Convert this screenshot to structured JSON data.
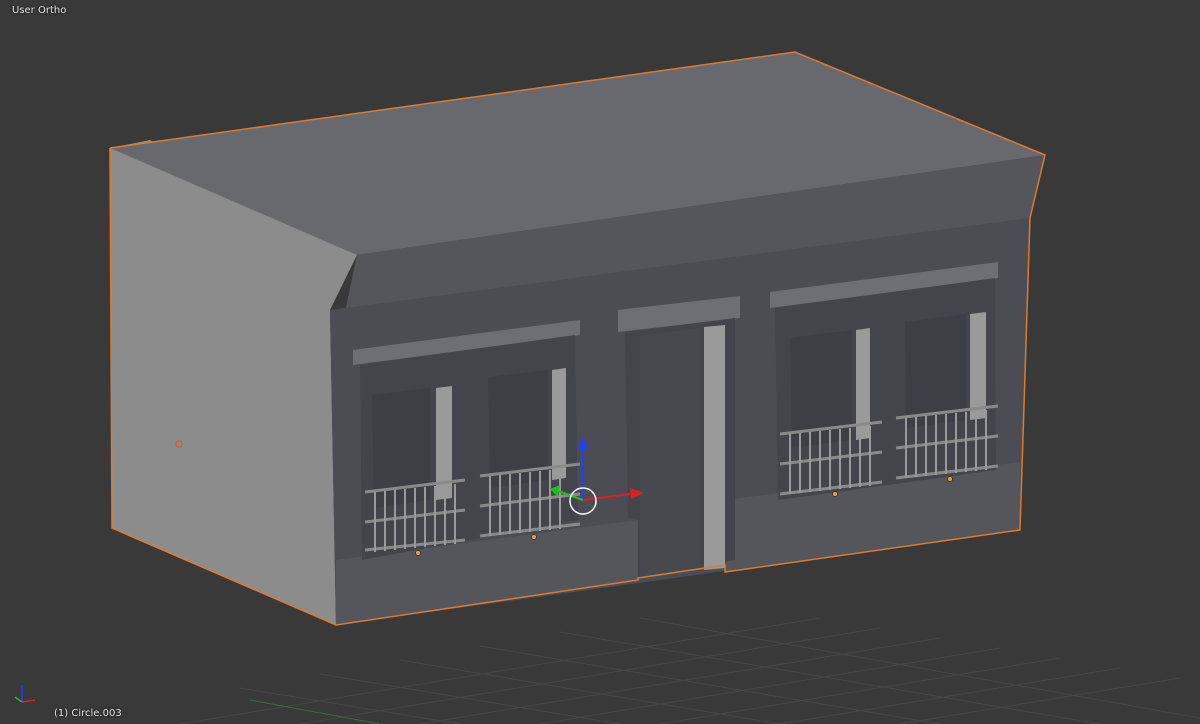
{
  "viewport": {
    "view_name": "User Ortho",
    "active_object": "(1) Circle.003",
    "background_color": "#393939",
    "grid_color": "#4a4a4a",
    "selection_outline_color": "#e07a2e"
  },
  "model": {
    "description_icon": "building-mesh",
    "wall_color": "#4e4e58",
    "side_wall_color": "#8a8a8a",
    "roof_color": "#6a6a73",
    "trim_color": "#8c8c8c"
  },
  "gizmo": {
    "x_axis_color": "#e02020",
    "y_axis_color": "#20c020",
    "z_axis_color": "#2040ff"
  }
}
